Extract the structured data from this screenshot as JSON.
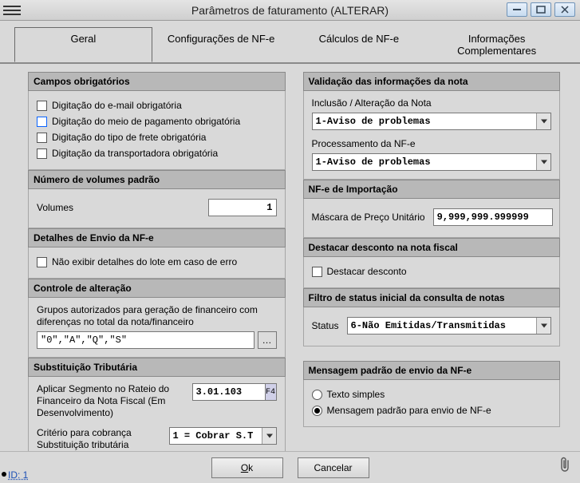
{
  "window": {
    "title": "Parâmetros de faturamento (ALTERAR)"
  },
  "tabs": {
    "geral": "Geral",
    "config_nfe": "Configurações de NF-e",
    "calculos_nfe": "Cálculos de NF-e",
    "info_compl": "Informações Complementares"
  },
  "left": {
    "campos_obrig": {
      "header": "Campos obrigatórios",
      "email": "Digitação do e-mail obrigatória",
      "meio_pag": "Digitação do meio de pagamento obrigatória",
      "tipo_frete": "Digitação do tipo de frete obrigatória",
      "transportadora": "Digitação da transportadora obrigatória"
    },
    "num_vol": {
      "header": "Número de volumes padrão",
      "label": "Volumes",
      "value": "1"
    },
    "detalhes_envio": {
      "header": "Detalhes de Envio da NF-e",
      "checkbox": "Não exibir detalhes do lote em caso de erro"
    },
    "controle_alt": {
      "header": "Controle de alteração",
      "desc": "Grupos autorizados para geração de financeiro com diferenças no total da nota/financeiro",
      "value": "\"0\",\"A\",\"Q\",\"S\""
    },
    "subst_trib": {
      "header": "Substituição Tributária",
      "seg_label": "Aplicar Segmento no Rateio do Financeiro da Nota Fiscal (Em Desenvolvimento)",
      "seg_value": "3.01.103",
      "seg_side": "F4",
      "crit_label": "Critério para cobrança Substituição tributária",
      "crit_value": "1 = Cobrar S.T"
    }
  },
  "right": {
    "validacao": {
      "header": "Validação das informações da nota",
      "incl_label": "Inclusão / Alteração da Nota",
      "incl_value": "1-Aviso de problemas",
      "proc_label": "Processamento da NF-e",
      "proc_value": "1-Aviso de problemas"
    },
    "importacao": {
      "header": "NF-e de Importação",
      "mask_label": "Máscara de Preço Unitário",
      "mask_value": "9,999,999.999999"
    },
    "destacar": {
      "header": "Destacar desconto na nota fiscal",
      "checkbox": "Destacar desconto"
    },
    "filtro_status": {
      "header": "Filtro de status inicial da consulta de notas",
      "label": "Status",
      "value": "6-Não Emitidas/Transmitidas"
    },
    "msg_padrao": {
      "header": "Mensagem padrão de envio da NF-e",
      "opt1": "Texto simples",
      "opt2": "Mensagem padrão para envio de NF-e"
    }
  },
  "footer": {
    "ok": "Ok",
    "cancelar": "Cancelar",
    "id": "ID: 1"
  }
}
